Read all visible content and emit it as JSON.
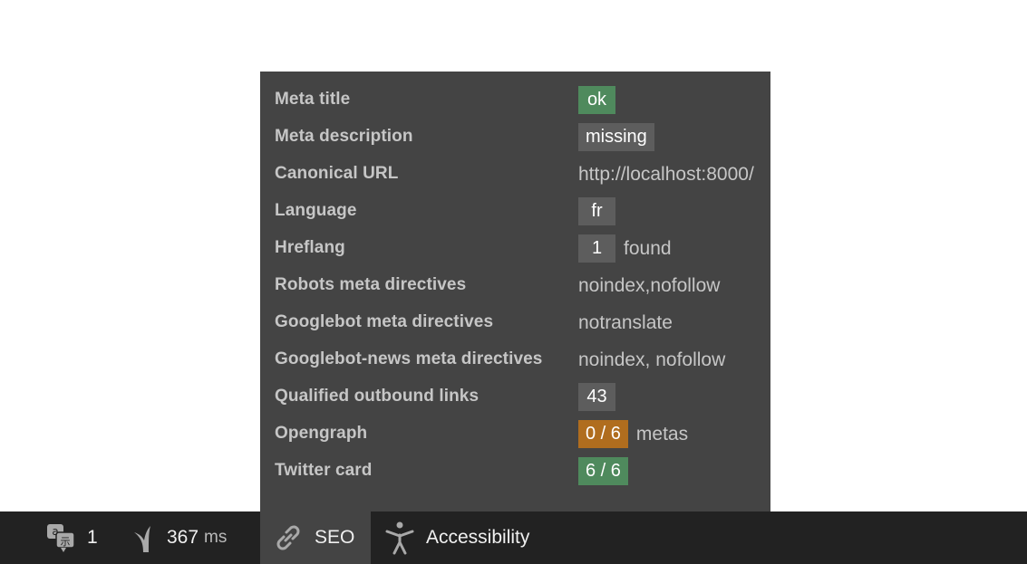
{
  "seo_panel": {
    "rows": [
      {
        "label": "Meta title",
        "value": "ok",
        "style": "green"
      },
      {
        "label": "Meta description",
        "value": "missing",
        "style": "gray"
      },
      {
        "label": "Canonical URL",
        "value": "http://localhost:8000/",
        "style": "plain"
      },
      {
        "label": "Language",
        "value": "fr",
        "style": "gray"
      },
      {
        "label": "Hreflang",
        "value": "1",
        "style": "gray",
        "suffix": "found"
      },
      {
        "label": "Robots meta directives",
        "value": "noindex,nofollow",
        "style": "plain"
      },
      {
        "label": "Googlebot meta directives",
        "value": "notranslate",
        "style": "plain"
      },
      {
        "label": "Googlebot-news meta directives",
        "value": "noindex, nofollow",
        "style": "plain"
      },
      {
        "label": "Qualified outbound links",
        "value": "43",
        "style": "gray"
      },
      {
        "label": "Opengraph",
        "value": "0 / 6",
        "style": "orange",
        "suffix": "metas"
      },
      {
        "label": "Twitter card",
        "value": "6 / 6",
        "style": "green"
      }
    ]
  },
  "toolbar": {
    "translation": {
      "icon": "translation-icon",
      "count": "1"
    },
    "performance": {
      "icon": "time-icon",
      "value": "367",
      "unit": "ms"
    },
    "seo": {
      "icon": "link-icon",
      "label": "SEO"
    },
    "accessibility": {
      "icon": "accessibility-icon",
      "label": "Accessibility"
    }
  },
  "colors": {
    "panel_bg": "#444444",
    "toolbar_bg": "#222222",
    "ok_green": "#4f8a5d",
    "neutral_gray": "#5d5d5d",
    "warning_orange": "#b06d1e"
  }
}
